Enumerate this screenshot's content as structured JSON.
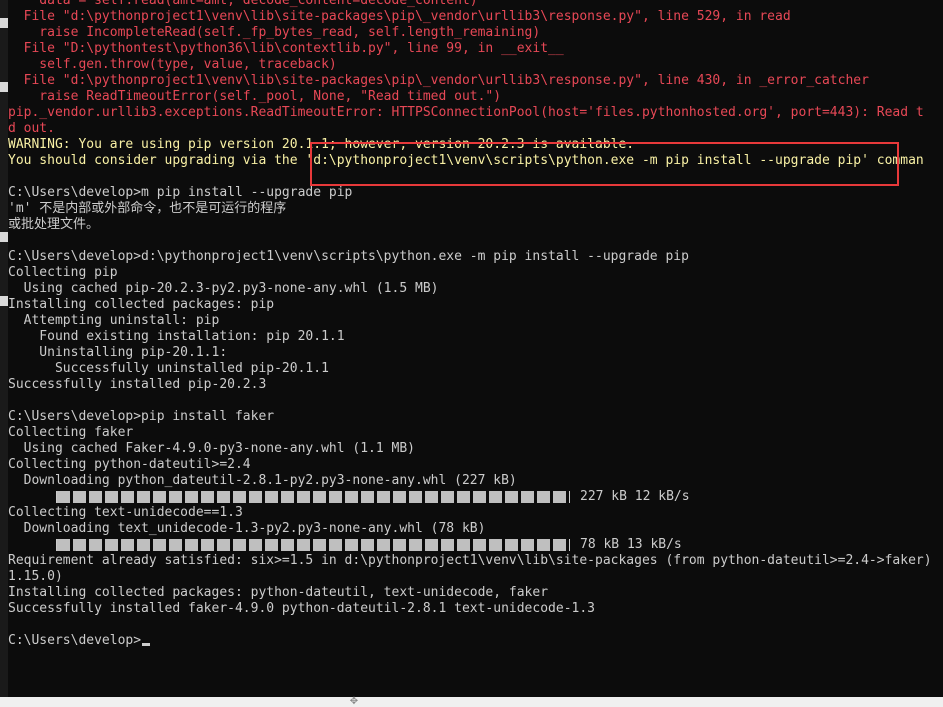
{
  "console": {
    "lines": [
      {
        "text": "    data = self.read(amt=amt, decode_content=decode_content)",
        "color": "red"
      },
      {
        "text": "  File \"d:\\pythonproject1\\venv\\lib\\site-packages\\pip\\_vendor\\urllib3\\response.py\", line 529, in read",
        "color": "red"
      },
      {
        "text": "    raise IncompleteRead(self._fp_bytes_read, self.length_remaining)",
        "color": "red"
      },
      {
        "text": "  File \"D:\\pythontest\\python36\\lib\\contextlib.py\", line 99, in __exit__",
        "color": "red"
      },
      {
        "text": "    self.gen.throw(type, value, traceback)",
        "color": "red"
      },
      {
        "text": "  File \"d:\\pythonproject1\\venv\\lib\\site-packages\\pip\\_vendor\\urllib3\\response.py\", line 430, in _error_catcher",
        "color": "red"
      },
      {
        "text": "    raise ReadTimeoutError(self._pool, None, \"Read timed out.\")",
        "color": "red"
      },
      {
        "text": "pip._vendor.urllib3.exceptions.ReadTimeoutError: HTTPSConnectionPool(host='files.pythonhosted.org', port=443): Read t",
        "color": "red"
      },
      {
        "text": "d out.",
        "color": "red"
      },
      {
        "text": "WARNING: You are using pip version 20.1.1; however, version 20.2.3 is available.",
        "color": "yellow"
      },
      {
        "text": "You should consider upgrading via the 'd:\\pythonproject1\\venv\\scripts\\python.exe -m pip install --upgrade pip' comman",
        "color": "yellow"
      },
      {
        "text": "",
        "color": "white"
      },
      {
        "text": "C:\\Users\\develop>m pip install --upgrade pip",
        "color": "white"
      },
      {
        "text": "'m' 不是内部或外部命令，也不是可运行的程序",
        "color": "white"
      },
      {
        "text": "或批处理文件。",
        "color": "white"
      },
      {
        "text": "",
        "color": "white"
      },
      {
        "text": "C:\\Users\\develop>d:\\pythonproject1\\venv\\scripts\\python.exe -m pip install --upgrade pip",
        "color": "white"
      },
      {
        "text": "Collecting pip",
        "color": "white"
      },
      {
        "text": "  Using cached pip-20.2.3-py2.py3-none-any.whl (1.5 MB)",
        "color": "white"
      },
      {
        "text": "Installing collected packages: pip",
        "color": "white"
      },
      {
        "text": "  Attempting uninstall: pip",
        "color": "white"
      },
      {
        "text": "    Found existing installation: pip 20.1.1",
        "color": "white"
      },
      {
        "text": "    Uninstalling pip-20.1.1:",
        "color": "white"
      },
      {
        "text": "      Successfully uninstalled pip-20.1.1",
        "color": "white"
      },
      {
        "text": "Successfully installed pip-20.2.3",
        "color": "white"
      },
      {
        "text": "",
        "color": "white"
      },
      {
        "text": "C:\\Users\\develop>pip install faker",
        "color": "white"
      },
      {
        "text": "Collecting faker",
        "color": "white"
      },
      {
        "text": "  Using cached Faker-4.9.0-py3-none-any.whl (1.1 MB)",
        "color": "white"
      },
      {
        "text": "Collecting python-dateutil>=2.4",
        "color": "white"
      },
      {
        "text": "  Downloading python_dateutil-2.8.1-py2.py3-none-any.whl (227 kB)",
        "color": "white"
      },
      {
        "progress": true,
        "label": "227 kB 12 kB/s",
        "fraction": 1.0
      },
      {
        "text": "Collecting text-unidecode==1.3",
        "color": "white"
      },
      {
        "text": "  Downloading text_unidecode-1.3-py2.py3-none-any.whl (78 kB)",
        "color": "white"
      },
      {
        "progress": true,
        "label": "78 kB 13 kB/s",
        "fraction": 1.0
      },
      {
        "text": "Requirement already satisfied: six>=1.5 in d:\\pythonproject1\\venv\\lib\\site-packages (from python-dateutil>=2.4->faker)",
        "color": "white"
      },
      {
        "text": "1.15.0)",
        "color": "white"
      },
      {
        "text": "Installing collected packages: python-dateutil, text-unidecode, faker",
        "color": "white"
      },
      {
        "text": "Successfully installed faker-4.9.0 python-dateutil-2.8.1 text-unidecode-1.3",
        "color": "white"
      },
      {
        "text": "",
        "color": "white"
      },
      {
        "text": "C:\\Users\\develop>",
        "color": "white",
        "cursor": true
      }
    ]
  },
  "colors": {
    "background": "#0c0c0c",
    "error_text": "#e74856",
    "warning_text": "#f9f1a5",
    "normal_text": "#cccccc",
    "highlight_box": "#e8393a"
  },
  "icons": {
    "resize_grip": "move-icon"
  }
}
